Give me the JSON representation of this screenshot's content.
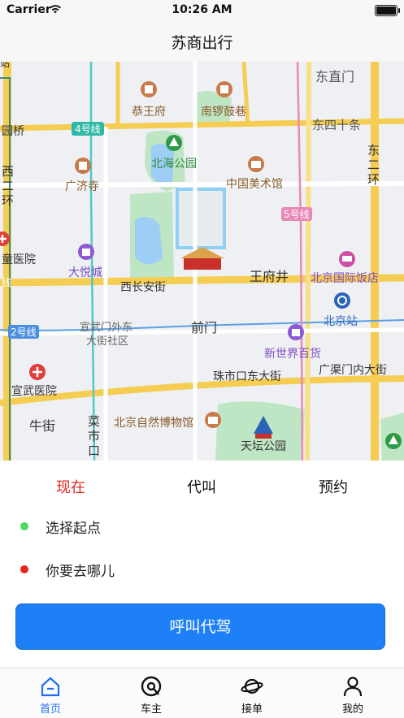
{
  "status": {
    "carrier": "Carrier",
    "time": "10:26 AM"
  },
  "nav": {
    "title": "苏商出行"
  },
  "map": {
    "labels": {
      "l1": "东直门",
      "l2": "恭王府",
      "l3": "南锣鼓巷",
      "l4": "园桥",
      "l5": "4号线",
      "l6": "东四十条",
      "l7": "北海公园",
      "l8": "广济寺",
      "l9": "中国美术馆",
      "l10": "西",
      "l11": "二",
      "l12": "环",
      "l13": "东",
      "l14": "二",
      "l15": "环",
      "l16": "5号线",
      "l17": "童医院",
      "l18": "大悦城",
      "l19": "王府井",
      "l20": "北京国际饭店",
      "l21": "西长安街",
      "l22": "北京站",
      "l23": "宣武门外东",
      "l24": "大街社区",
      "l25": "前门",
      "l26": "2号线",
      "l27": "新世界百货",
      "l28": "广渠门内大街",
      "l29": "珠市口东大街",
      "l30": "宣武医院",
      "l31": "牛街",
      "l32": "北京自然博物馆",
      "l33": "菜",
      "l34": "市",
      "l35": "口",
      "l36": "天坛公园",
      "l37": "线",
      "l38": "站"
    }
  },
  "tabs": {
    "now": "现在",
    "proxy": "代叫",
    "reserve": "预约"
  },
  "origin": {
    "placeholder": "选择起点",
    "dot_color": "#4cd964"
  },
  "destination": {
    "placeholder": "你要去哪儿",
    "dot_color": "#e4261d"
  },
  "call_button": "呼叫代驾",
  "tabbar": {
    "home": "首页",
    "owner": "车主",
    "orders": "接单",
    "mine": "我的"
  },
  "colors": {
    "accent": "#1e80f6",
    "active_tab": "#e4261d",
    "tabbar_active": "#1e6ff0"
  }
}
